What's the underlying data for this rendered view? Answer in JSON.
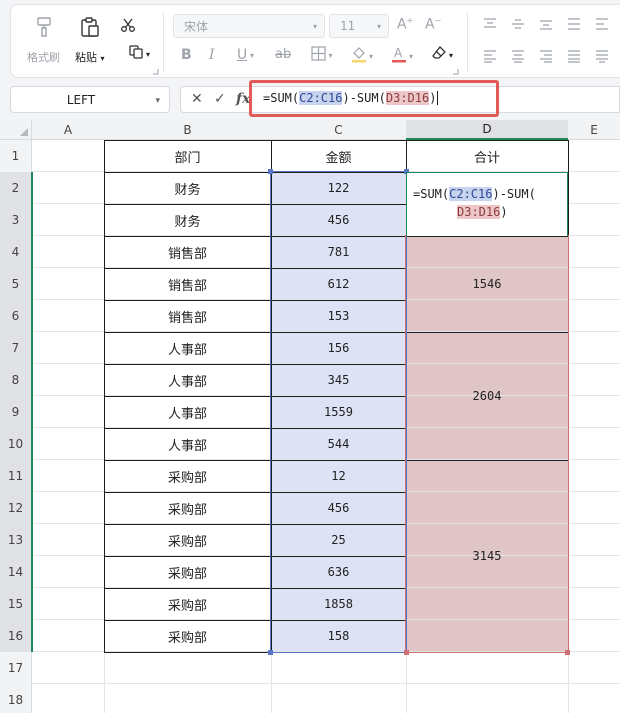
{
  "ribbon": {
    "format_painter_label": "格式刷",
    "paste_label": "粘贴",
    "font_name": "宋体",
    "font_size": "11",
    "bold": "B",
    "italic": "I",
    "underline": "U",
    "strikethrough": "ab",
    "icons": [
      "format-painter-icon",
      "paste-icon",
      "cut-icon",
      "copy-icon",
      "font-grow-icon",
      "font-shrink-icon",
      "borders-icon",
      "fill-color-icon",
      "font-color-icon",
      "clear-icon",
      "align-icons"
    ]
  },
  "formula_bar": {
    "name_box": "LEFT",
    "cancel": "✕",
    "confirm": "✓",
    "fx": "fx",
    "formula_parts": [
      "=SUM(",
      "C2:C16",
      ")-SUM(",
      "D3:D16",
      ")"
    ]
  },
  "columns": [
    "A",
    "B",
    "C",
    "D",
    "E"
  ],
  "rows": [
    "1",
    "2",
    "3",
    "4",
    "5",
    "6",
    "7",
    "8",
    "9",
    "10",
    "11",
    "12",
    "13",
    "14",
    "15",
    "16",
    "17",
    "18"
  ],
  "table": {
    "headers": [
      "部门",
      "金额",
      "合计"
    ],
    "departments": [
      "财务",
      "财务",
      "销售部",
      "销售部",
      "销售部",
      "人事部",
      "人事部",
      "人事部",
      "人事部",
      "采购部",
      "采购部",
      "采购部",
      "采购部",
      "采购部",
      "采购部"
    ],
    "amounts": [
      "122",
      "456",
      "781",
      "612",
      "153",
      "156",
      "345",
      "1559",
      "544",
      "12",
      "456",
      "25",
      "636",
      "1858",
      "158"
    ],
    "editing_cell": {
      "line1_parts": [
        "=SUM(",
        "C2:C16",
        ")-SUM("
      ],
      "line2_parts": [
        "D3:D16",
        ")"
      ]
    },
    "totals": [
      "1546",
      "2604",
      "3145"
    ]
  },
  "colors": {
    "selection_blue": "#dde3f5",
    "selection_pink": "#dfc5c6",
    "active_green": "#1e8a5a",
    "highlight_red": "#e25a57"
  }
}
